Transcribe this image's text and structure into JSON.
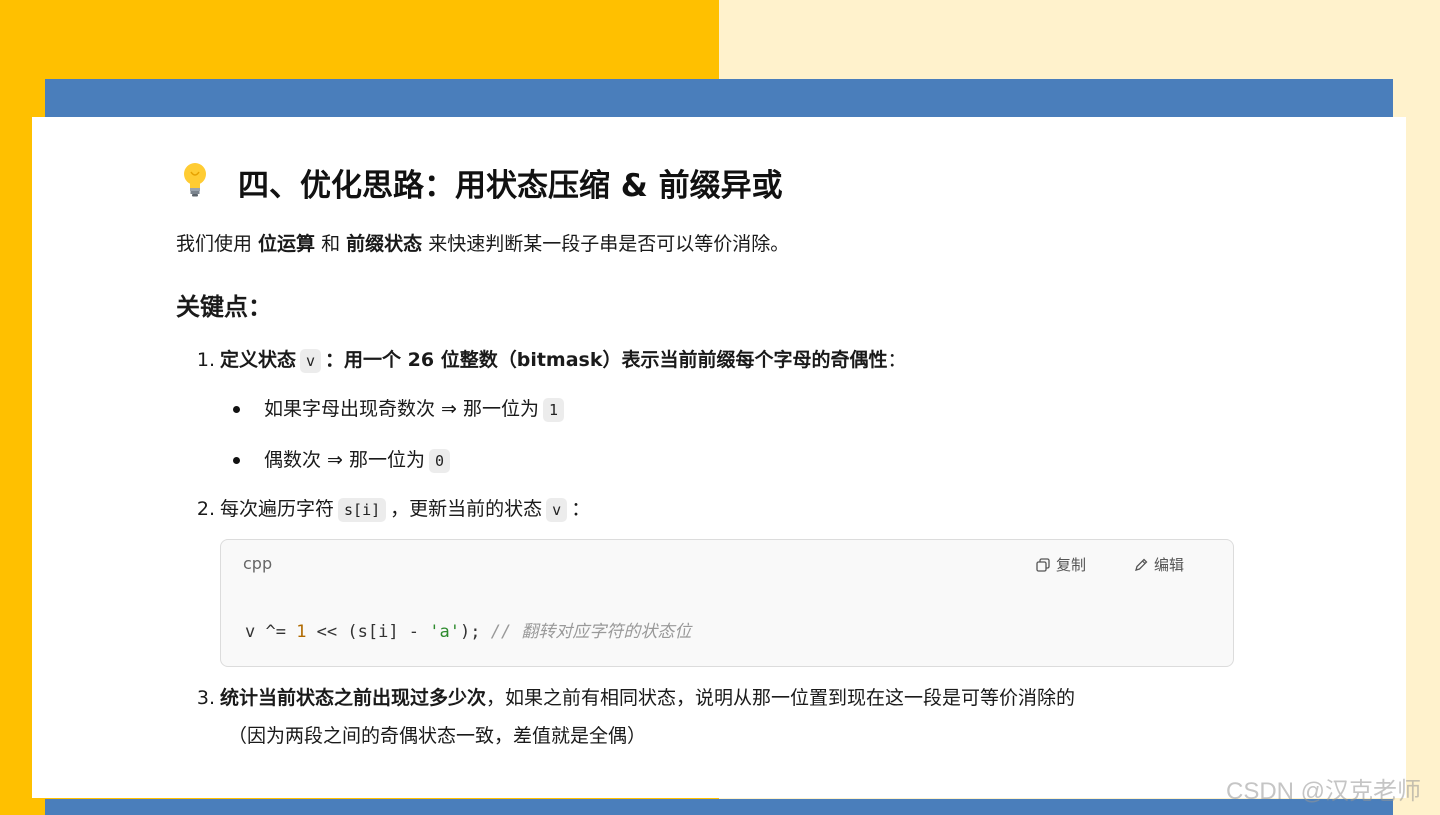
{
  "heading": "四、优化思路：用状态压缩 & 前缀异或",
  "intro": {
    "p1": "我们使用 ",
    "b1": "位运算",
    "p2": " 和 ",
    "b2": "前缀状态",
    "p3": " 来快速判断某一段子串是否可以等价消除。"
  },
  "subheading": "关键点：",
  "items": [
    {
      "num": "1.",
      "b_pre": "定义状态",
      "code": "v",
      "b_post": "：用一个 26 位整数（bitmask）表示当前前缀每个字母的奇偶性",
      "tail": "："
    },
    {
      "num": "2.",
      "pre": "每次遍历字符",
      "code1": "s[i]",
      "mid": "，更新当前的状态",
      "code2": "v",
      "tail": "："
    },
    {
      "num": "3.",
      "b": "统计当前状态之前出现过多少次",
      "text": "，如果之前有相同状态，说明从那一位置到现在这一段是可等价消除的",
      "line2": "（因为两段之间的奇偶状态一致，差值就是全偶）"
    }
  ],
  "bullets": [
    {
      "text": "如果字母出现奇数次 ⇒ 那一位为",
      "code": "1"
    },
    {
      "text": "偶数次 ⇒ 那一位为",
      "code": "0"
    }
  ],
  "code_block": {
    "lang": "cpp",
    "copy_label": "复制",
    "edit_label": "编辑",
    "tokens": {
      "a": "v ^= ",
      "num": "1",
      "b": " << (s[i] - ",
      "str": "'a'",
      "c": "); ",
      "comment": "// 翻转对应字符的状态位"
    }
  },
  "watermark": "CSDN @汉克老师",
  "colors": {
    "left_bg": "#ffc000",
    "right_bg": "#fff2cc",
    "band": "#4a7ebb"
  },
  "icons": [
    "lightbulb-icon",
    "copy-icon",
    "edit-icon"
  ]
}
